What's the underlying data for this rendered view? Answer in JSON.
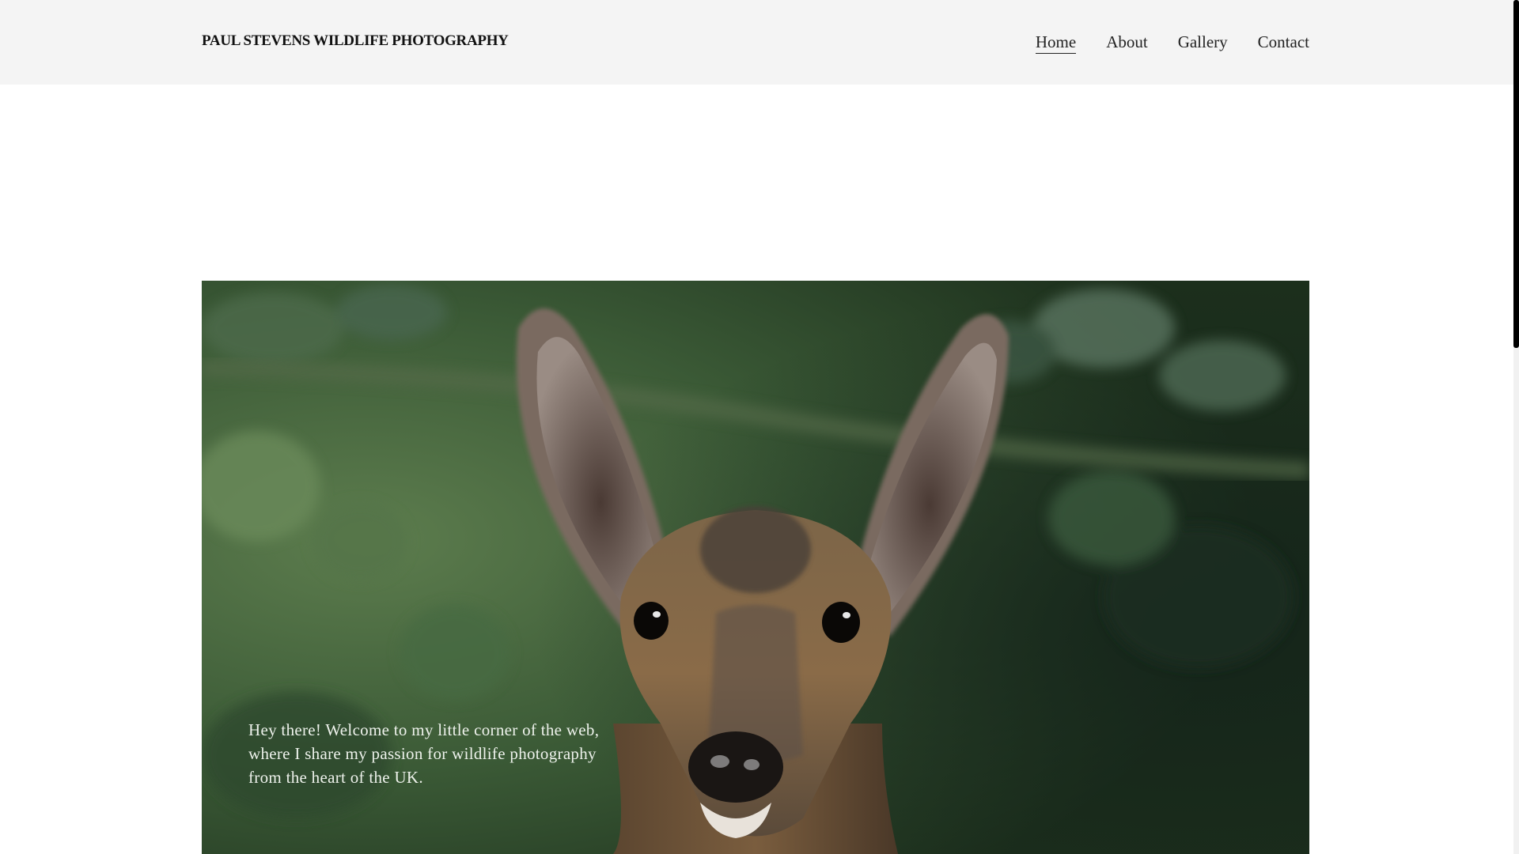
{
  "header": {
    "site_title": "PAUL STEVENS WILDLIFE PHOTOGRAPHY",
    "nav": [
      {
        "label": "Home",
        "active": true
      },
      {
        "label": "About",
        "active": false
      },
      {
        "label": "Gallery",
        "active": false
      },
      {
        "label": "Contact",
        "active": false
      }
    ]
  },
  "hero": {
    "image": "roe-deer-photo",
    "text": "Hey there! Welcome to my little corner of the web, where I share my passion for wildlife photography from the heart of the UK."
  },
  "colors": {
    "header_bg": "#f4f4f4",
    "page_bg": "#ffffff",
    "hero_text": "#eef2ec"
  }
}
